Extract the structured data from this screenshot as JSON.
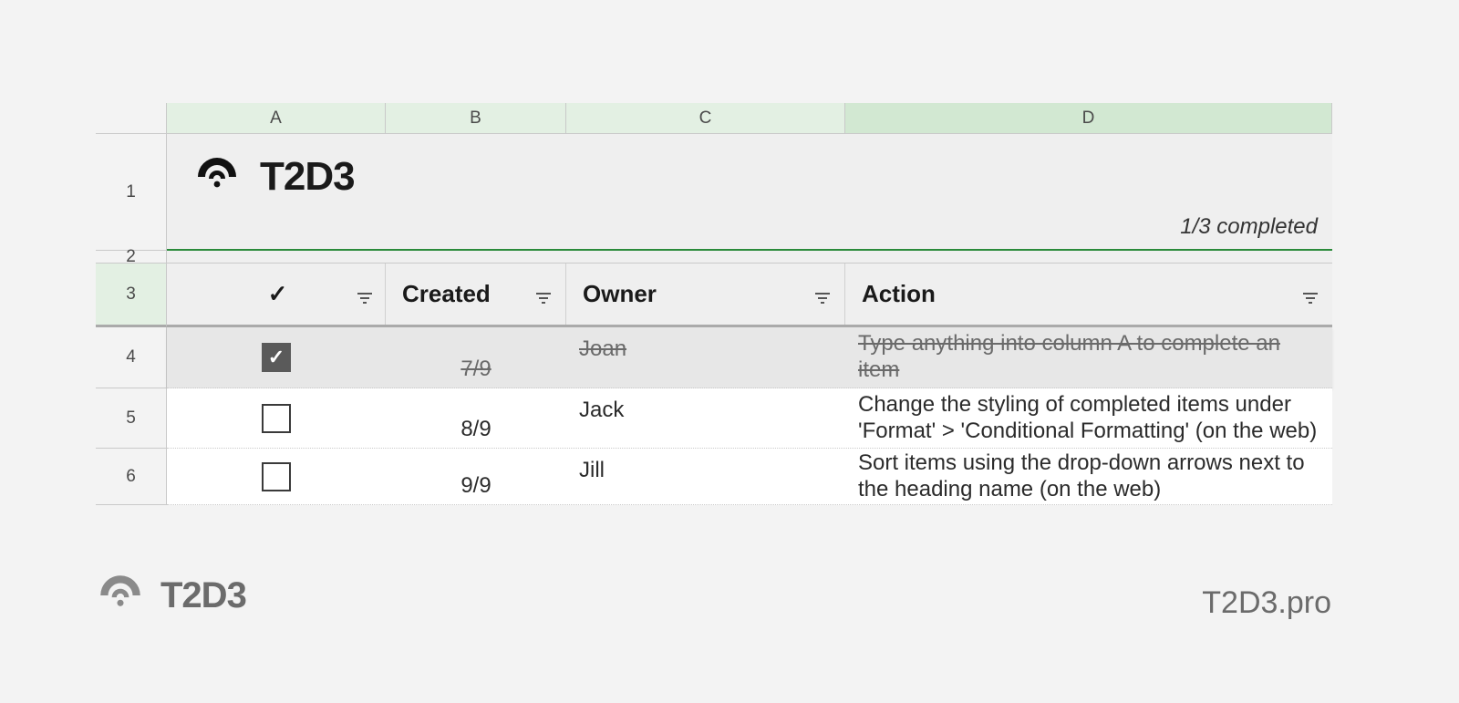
{
  "columns": {
    "A": "A",
    "B": "B",
    "C": "C",
    "D": "D"
  },
  "row_labels": {
    "r1": "1",
    "r2": "2",
    "r3": "3",
    "r4": "4",
    "r5": "5",
    "r6": "6"
  },
  "brand": {
    "name": "T2D3"
  },
  "completed_summary": "1/3 completed",
  "headers": {
    "check": "✓",
    "created": "Created",
    "owner": "Owner",
    "action": "Action"
  },
  "rows": [
    {
      "checked": true,
      "created": "7/9",
      "owner": "Joan",
      "action": "Type anything into column A to complete an item"
    },
    {
      "checked": false,
      "created": "8/9",
      "owner": "Jack",
      "action": "Change the styling of completed items under 'Format' > 'Conditional Formatting' (on the web)"
    },
    {
      "checked": false,
      "created": "9/9",
      "owner": "Jill",
      "action": "Sort items using the drop-down arrows next to the heading name (on the web)"
    }
  ],
  "footer": {
    "brand": "T2D3",
    "url": "T2D3.pro"
  }
}
